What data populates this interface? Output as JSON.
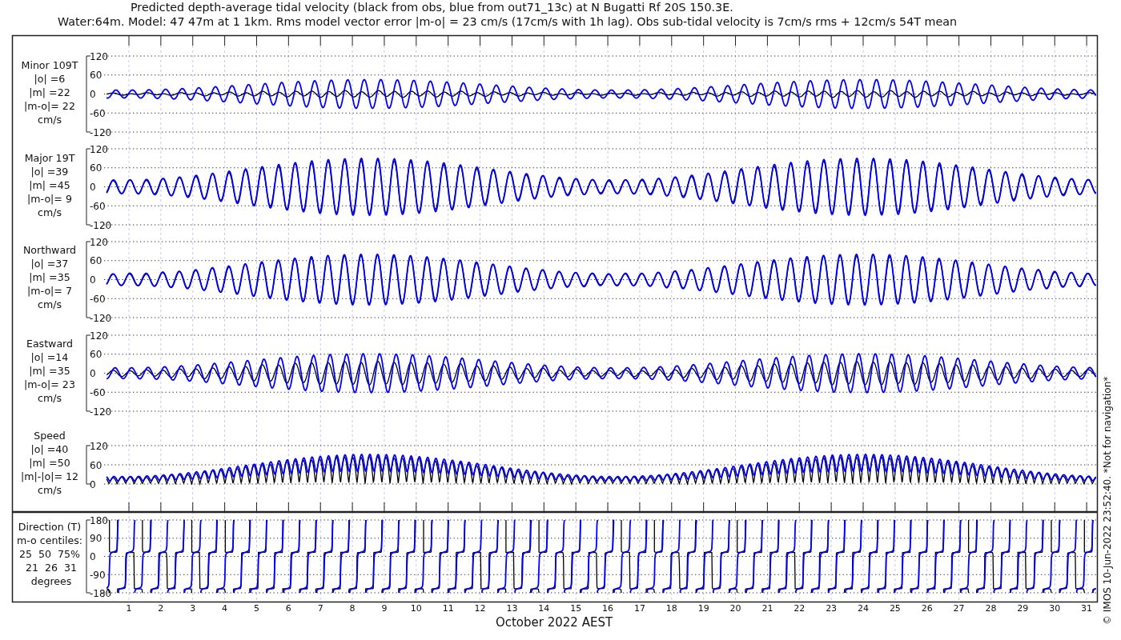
{
  "title_lines": [
    "Predicted depth-average tidal velocity (black from obs, blue from out71_13c) at N Bugatti Rf 20S 150.3E.",
    "Water:64m. Model: 47 47m at 1 1km. Rms model vector error |m-o| = 23 cm/s (17cm/s with 1h lag). Obs sub-tidal velocity is 7cm/s rms + 12cm/s 54T mean"
  ],
  "panels": [
    {
      "kind": "minor",
      "label_lines": [
        "Minor 109T",
        "|o| =6",
        "|m| =22",
        "|m-o|= 22",
        "cm/s"
      ],
      "yticks": [
        "120",
        "60",
        "0",
        "-60",
        "-120"
      ]
    },
    {
      "kind": "major",
      "label_lines": [
        "Major 19T",
        "|o| =39",
        "|m| =45",
        "|m-o|= 9",
        "cm/s"
      ],
      "yticks": [
        "120",
        "60",
        "0",
        "-60",
        "-120"
      ]
    },
    {
      "kind": "north",
      "label_lines": [
        "Northward",
        "|o| =37",
        "|m| =35",
        "|m-o|= 7",
        "cm/s"
      ],
      "yticks": [
        "120",
        "60",
        "0",
        "-60",
        "-120"
      ]
    },
    {
      "kind": "east",
      "label_lines": [
        "Eastward",
        "|o| =14",
        "|m| =35",
        "|m-o|= 23",
        "cm/s"
      ],
      "yticks": [
        "120",
        "60",
        "0",
        "-60",
        "-120"
      ]
    },
    {
      "kind": "speed",
      "label_lines": [
        "Speed",
        "|o| =40",
        "|m| =50",
        "|m|-|o|= 12",
        "cm/s"
      ],
      "yticks": [
        "120",
        "60",
        "0"
      ]
    },
    {
      "kind": "direction",
      "label_lines": [
        "Direction (T)",
        "m-o centiles:",
        "25  50  75%",
        " 21  26  31",
        " degrees"
      ],
      "yticks": [
        "180",
        "90",
        "0",
        "-90",
        "-180"
      ]
    }
  ],
  "x_axis": {
    "ticks": [
      "1",
      "2",
      "3",
      "4",
      "5",
      "6",
      "7",
      "8",
      "9",
      "10",
      "11",
      "12",
      "13",
      "14",
      "15",
      "16",
      "17",
      "18",
      "19",
      "20",
      "21",
      "22",
      "23",
      "24",
      "25",
      "26",
      "27",
      "28",
      "29",
      "30",
      "31"
    ],
    "label": "October 2022 AEST"
  },
  "credit": "© IMOS 10-Jun-2022 23:52:40. *Not for navigation*"
}
